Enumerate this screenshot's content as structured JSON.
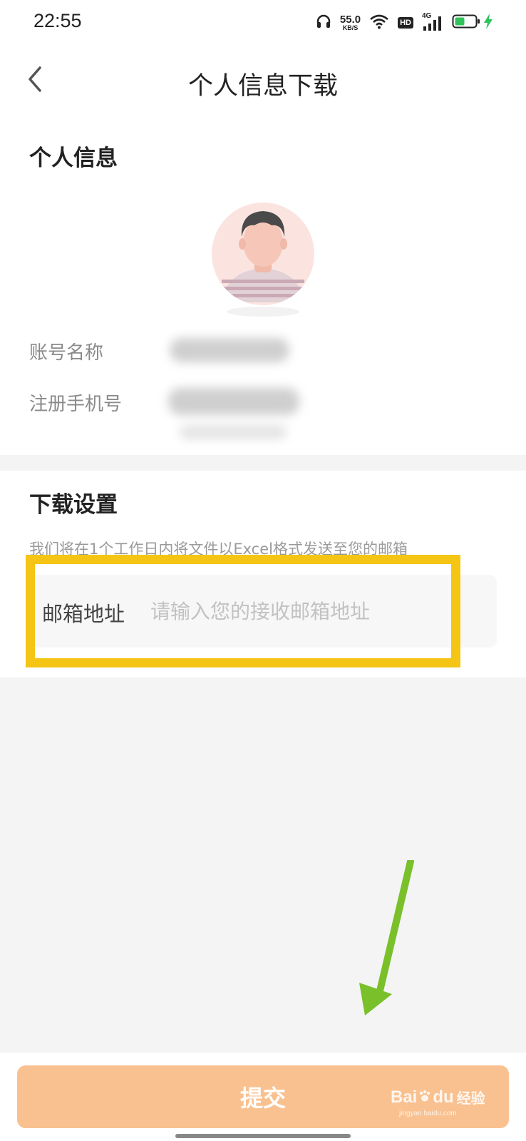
{
  "status_bar": {
    "time": "22:55",
    "net_speed_value": "55.0",
    "net_speed_unit": "KB/S",
    "hd_badge": "HD",
    "network_type": "4G",
    "icons": [
      "headphones-icon",
      "wifi-icon",
      "signal-icon",
      "battery-icon",
      "charging-icon"
    ]
  },
  "header": {
    "title": "个人信息下载",
    "back_icon": "chevron-left-icon"
  },
  "personal_info": {
    "section_title": "个人信息",
    "fields": [
      {
        "label": "账号名称"
      },
      {
        "label": "注册手机号"
      }
    ]
  },
  "download_settings": {
    "section_title": "下载设置",
    "hint": "我们将在1个工作日内将文件以Excel格式发送至您的邮箱",
    "email_label": "邮箱地址",
    "email_placeholder": "请输入您的接收邮箱地址",
    "email_value": ""
  },
  "footer": {
    "submit_label": "提交"
  },
  "watermark": {
    "text": "Bai",
    "text2": "du",
    "suffix": "经验",
    "url": "jingyan.baidu.com"
  },
  "colors": {
    "submit_bg": "#f9c190",
    "highlight": "#f5c516",
    "arrow": "#7ac02a",
    "page_bg": "#f4f4f4"
  }
}
